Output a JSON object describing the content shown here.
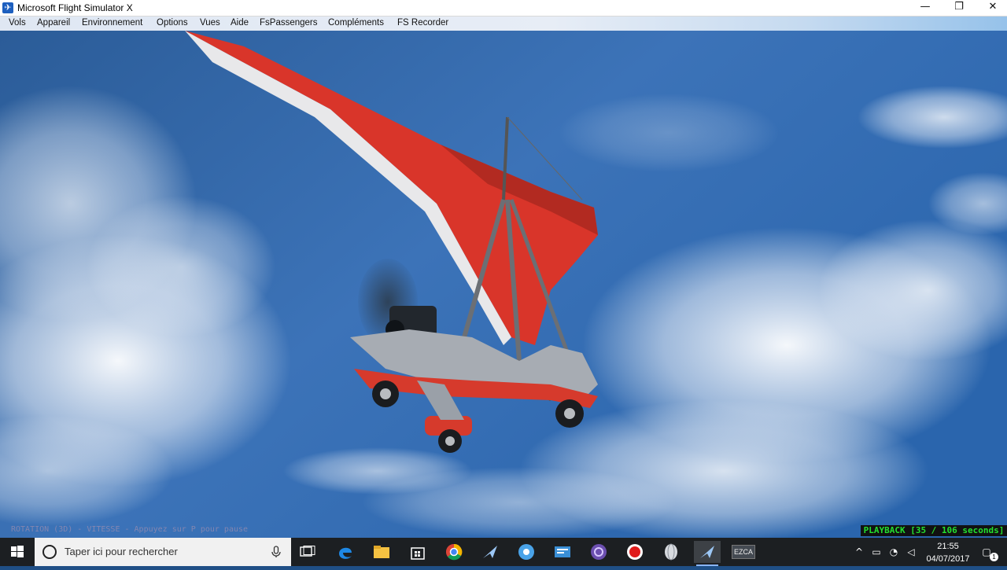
{
  "window": {
    "title": "Microsoft Flight Simulator X",
    "minimize_symbol": "—",
    "maximize_symbol": "❐",
    "close_symbol": "✕",
    "app_icon": "fsx-plane-icon"
  },
  "menu": {
    "items": [
      {
        "label": "Vols"
      },
      {
        "label": "Appareil"
      },
      {
        "label": "Environnement"
      },
      {
        "label": "Options"
      },
      {
        "label": "Vues"
      },
      {
        "label": "Aide"
      },
      {
        "label": "FsPassengers"
      },
      {
        "label": "Compléments"
      },
      {
        "label": "FS Recorder"
      }
    ]
  },
  "scene": {
    "description_icon": "ultralight-trike-aircraft",
    "playback_text": "PLAYBACK [35 / 106 seconds]",
    "playback": {
      "current_seconds": 35,
      "total_seconds": 106
    },
    "faint_message": "ROTATION (3D) - VITESSE - Appuyez sur P pour pause"
  },
  "taskbar": {
    "search_placeholder": "Taper ici pour rechercher",
    "apps": [
      "task-view-icon",
      "edge-icon",
      "file-explorer-icon",
      "store-icon",
      "chrome-icon",
      "fsx-plane-icon",
      "ie-tool-icon",
      "news-icon",
      "app-swirl-icon",
      "record-icon",
      "globe-icon",
      "fsx-active-icon",
      "ezca-icon"
    ],
    "ezca_label": "EZCA",
    "clock": {
      "time": "21:55",
      "date": "04/07/2017"
    },
    "notification_count": "1"
  },
  "colors": {
    "sky_dark": "#1f4f86",
    "sky_light": "#5d8fcf",
    "wing_red": "#d9352a",
    "playback_green": "#23e02e"
  }
}
